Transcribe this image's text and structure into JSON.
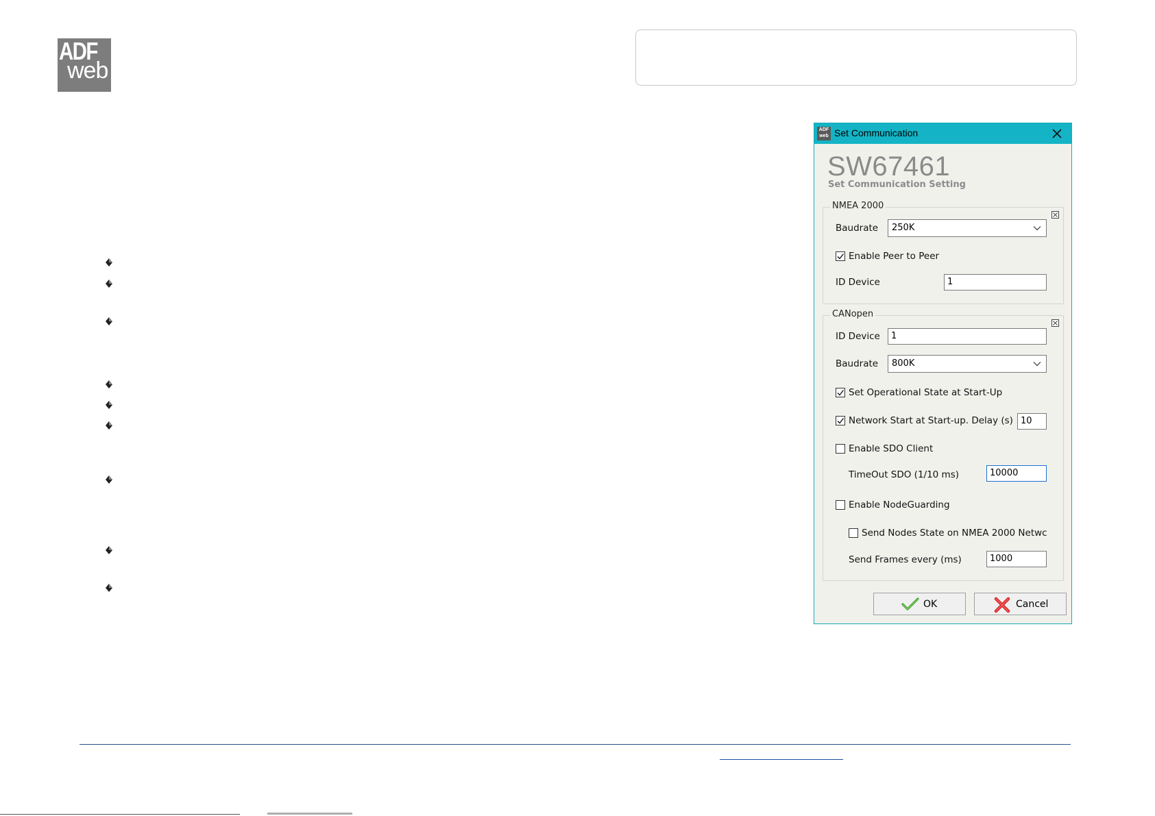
{
  "logo": {
    "line1": "ADF",
    "line2": "web"
  },
  "dialog": {
    "window_title": "Set Communication",
    "product_code": "SW67461",
    "subtitle": "Set Communication Setting",
    "nmea": {
      "legend": "NMEA 2000",
      "baudrate_label": "Baudrate",
      "baudrate_value": "250K",
      "peer_label": "Enable Peer to Peer",
      "peer_checked": true,
      "id_label": "ID Device",
      "id_value": "1"
    },
    "canopen": {
      "legend": "CANopen",
      "id_label": "ID Device",
      "id_value": "1",
      "baudrate_label": "Baudrate",
      "baudrate_value": "800K",
      "operational_label": "Set Operational State at Start-Up",
      "operational_checked": true,
      "network_start_label": "Network Start at Start-up. Delay (s)",
      "network_start_checked": true,
      "delay_value": "10",
      "sdo_label": "Enable SDO Client",
      "sdo_checked": false,
      "timeout_label": "TimeOut SDO (1/10 ms)",
      "timeout_value": "10000",
      "nodeguarding_label": "Enable NodeGuarding",
      "nodeguarding_checked": false,
      "send_state_label": "Send Nodes State on NMEA 2000 Netwc",
      "send_state_checked": false,
      "send_frames_label": "Send Frames every (ms)",
      "send_frames_value": "1000"
    },
    "ok_label": "OK",
    "cancel_label": "Cancel"
  },
  "icons": {
    "bullet": "diamond-bullet-icon",
    "close": "close-icon",
    "collapse": "collapse-box-icon",
    "dropdown": "chevron-down-icon",
    "check": "checkmark-icon",
    "ok": "green-check-icon",
    "cancel": "red-x-icon"
  },
  "colors": {
    "titlebar": "#14b4c6",
    "logo": "#7d7d7d",
    "footer_line": "#2a4f8a"
  }
}
